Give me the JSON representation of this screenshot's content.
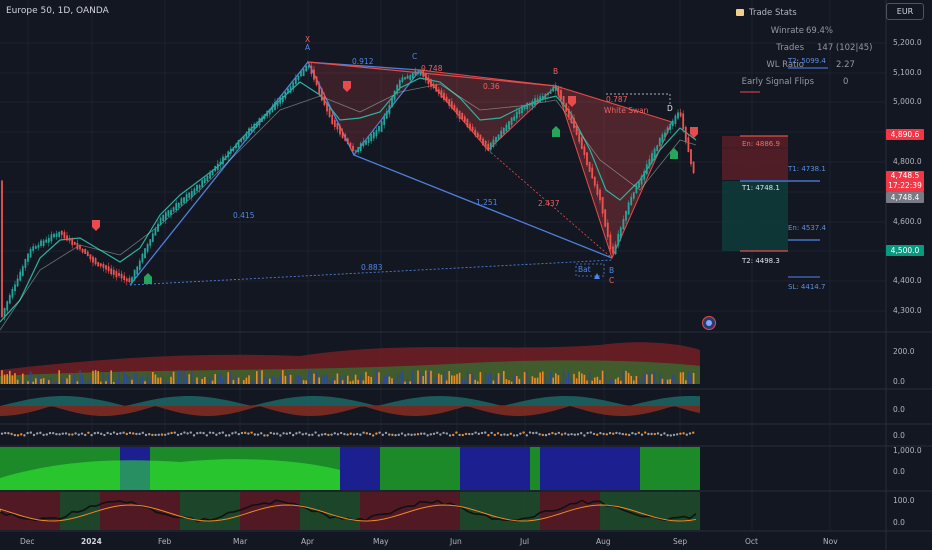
{
  "symbol": "Europe 50, 1D, OANDA",
  "currency_button": "EUR",
  "trade_stats": {
    "title": "Trade Stats",
    "rows": [
      {
        "label": "Winrate",
        "value": "69.4%"
      },
      {
        "label": "Trades",
        "value": "147 (102|45)"
      },
      {
        "label": "WL Ratio",
        "value": "2.27"
      },
      {
        "label": "Early Signal Flips",
        "value": "0"
      }
    ]
  },
  "price_tags": {
    "upper": {
      "value": "4,890.6",
      "color": "#f23645"
    },
    "last": {
      "value": "4,748.5",
      "time": "17:22:39",
      "color": "#f23645"
    },
    "level": {
      "value": "4,748.4",
      "color": "#787b86"
    },
    "t2": {
      "value": "4,500.0",
      "color": "#089981"
    }
  },
  "levels": {
    "t2_top": "T2: 5099.4",
    "entry_short": "En: 4886.9",
    "t1_short": "T1: 4738.1",
    "t1_long": "T1: 4748.1",
    "entry_long": "En: 4537.4",
    "t2_long": "T2: 4498.3",
    "sl": "SL: 4414.7"
  },
  "y_axis": {
    "price": [
      "5,200.0",
      "5,100.0",
      "5,000.0",
      "4,900.0",
      "4,800.0",
      "4,600.0",
      "4,500.0",
      "4,400.0",
      "4,300.0"
    ],
    "volume": [
      "200.0",
      "0.0"
    ],
    "osc1": [
      "0.0"
    ],
    "osc2": [
      "0.0"
    ],
    "osc3": [
      "1,000.0",
      "0.0"
    ],
    "osc4": [
      "100.0",
      "0.0"
    ]
  },
  "x_axis": [
    "Dec",
    "2024",
    "Feb",
    "Mar",
    "Apr",
    "May",
    "Jun",
    "Jul",
    "Aug",
    "Sep",
    "Oct",
    "Nov"
  ],
  "harmonic": {
    "points": {
      "X": "X",
      "A": "A",
      "B": "B",
      "C": "C",
      "D": "D"
    },
    "ratios": [
      "0.912",
      "0.748",
      "0.36",
      "0.787",
      "0.415",
      "1.251",
      "2.437",
      "0.883"
    ],
    "pattern_name": "Bat",
    "white_swan": "White Swan"
  },
  "colors": {
    "background": "#131722",
    "bull": "#26a69a",
    "bear": "#ef5350",
    "pattern_red": "#e84b4b",
    "pattern_blue": "#4f7fd9"
  }
}
